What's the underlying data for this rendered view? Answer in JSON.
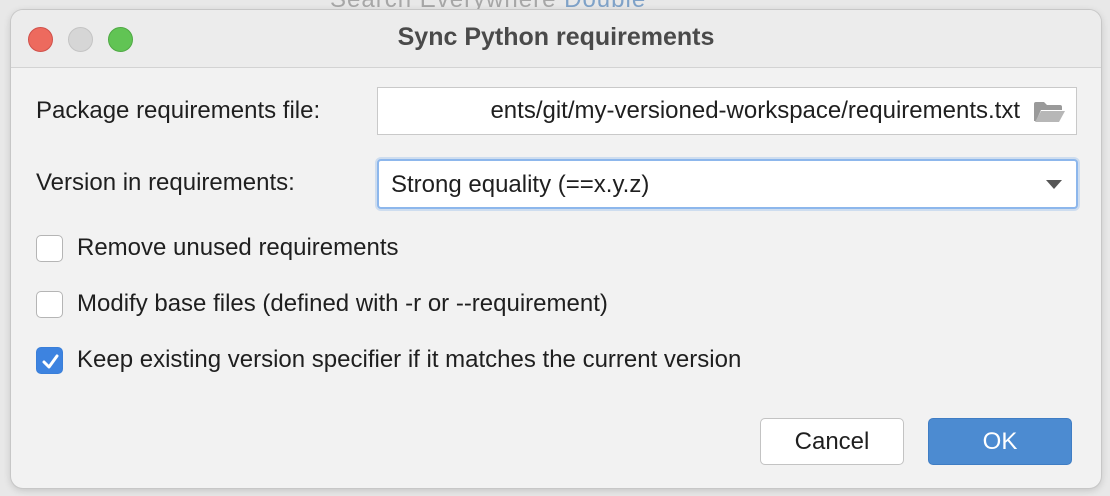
{
  "backdrop": {
    "partial_text_gray": "Search Everywhere",
    "partial_text_blue": "Double ^"
  },
  "dialog": {
    "title": "Sync Python requirements",
    "package_file": {
      "label": "Package requirements file:",
      "value": "ents/git/my-versioned-workspace/requirements.txt",
      "icon": "folder-open-icon"
    },
    "version": {
      "label": "Version in requirements:",
      "selected": "Strong equality (==x.y.z)"
    },
    "options": [
      {
        "label": "Remove unused requirements",
        "checked": false
      },
      {
        "label": "Modify base files (defined with -r or --requirement)",
        "checked": false
      },
      {
        "label": "Keep existing version specifier if it matches the current version",
        "checked": true
      }
    ],
    "buttons": {
      "cancel": "Cancel",
      "ok": "OK"
    }
  },
  "colors": {
    "accent": "#4c8bd1",
    "checkbox_checked": "#3d83e0",
    "focus_ring": "#8db7ec",
    "traffic_close": "#ed6a5e",
    "traffic_minimize": "#d6d6d6",
    "traffic_maximize": "#61c454"
  }
}
